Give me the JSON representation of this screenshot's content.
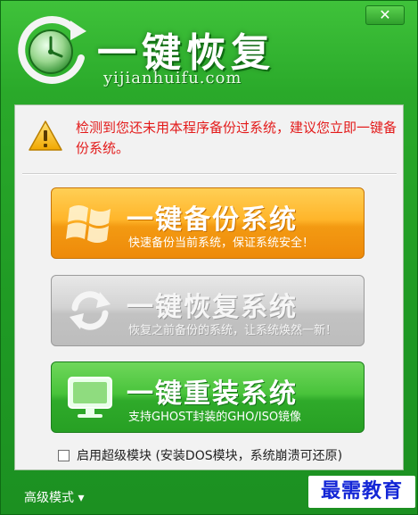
{
  "window": {
    "close_label": "✕",
    "title": "一键恢复",
    "subtitle": "yijianhuifu.com"
  },
  "warning": {
    "icon": "warning-icon",
    "text": "检测到您还未用本程序备份过系统，建议您立即一键备份系统。"
  },
  "buttons": [
    {
      "title": "一键备份系统",
      "desc": "快速备份当前系统，保证系统安全！",
      "icon": "windows-logo-icon"
    },
    {
      "title": "一键恢复系统",
      "desc": "恢复之前备份的系统，让系统焕然一新！",
      "icon": "restore-arrows-icon"
    },
    {
      "title": "一键重装系统",
      "desc": "支持GHOST封装的GHO/ISO镜像",
      "icon": "monitor-icon"
    }
  ],
  "super_mode": {
    "label": "启用超级模块 (安装DOS模块，系统崩溃可还原)",
    "checked": false
  },
  "footer": {
    "advanced_label": "高级模式 ▾",
    "watermark": "最需教育"
  },
  "colors": {
    "frame_green": "#2aa92a",
    "warning_red": "#e31b1b",
    "backup_orange": "#ffb52a",
    "restore_gray": "#c2c2c2",
    "reinstall_green": "#49c33b",
    "watermark_blue": "#1326d6"
  }
}
